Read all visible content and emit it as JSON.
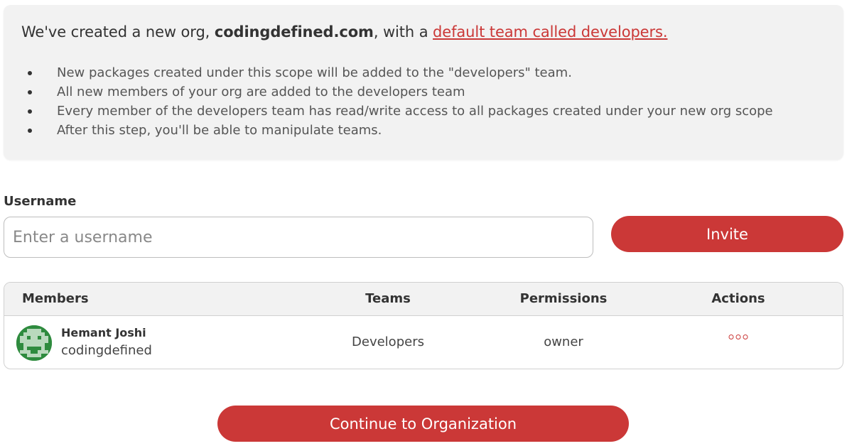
{
  "info": {
    "headline_prefix": "We've created a new org, ",
    "org_name": "codingdefined.com",
    "headline_middle": ", with a ",
    "team_link": "default team called developers.",
    "bullets": [
      "New packages created under this scope will be added to the \"developers\" team.",
      "All new members of your org are added to the developers team",
      "Every member of the developers team has read/write access to all packages created under your new org scope",
      "After this step, you'll be able to manipulate teams."
    ]
  },
  "invite": {
    "label": "Username",
    "placeholder": "Enter a username",
    "value": "",
    "button": "Invite"
  },
  "table": {
    "headers": {
      "members": "Members",
      "teams": "Teams",
      "permissions": "Permissions",
      "actions": "Actions"
    },
    "rows": [
      {
        "name": "Hemant Joshi",
        "username": "codingdefined",
        "team": "Developers",
        "permission": "owner",
        "avatar": "pixel-invader-avatar",
        "actions_icon": "more-options-icon"
      }
    ]
  },
  "footer": {
    "continue_button": "Continue to Organization"
  },
  "colors": {
    "accent": "#cb3837",
    "panel": "#f2f2f2",
    "avatar_bg": "#2e8b3e"
  }
}
